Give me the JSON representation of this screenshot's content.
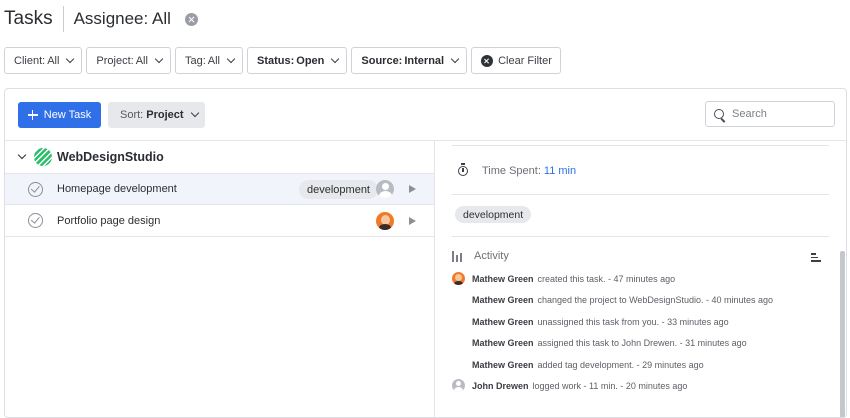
{
  "header": {
    "title": "Tasks",
    "assignee": "Assignee: All"
  },
  "filters": [
    {
      "label": "Client:",
      "value": "All",
      "bold": false
    },
    {
      "label": "Project:",
      "value": "All",
      "bold": false
    },
    {
      "label": "Tag:",
      "value": "All",
      "bold": false
    },
    {
      "label": "Status:",
      "value": "Open",
      "bold": true
    },
    {
      "label": "Source:",
      "value": "Internal",
      "bold": true
    }
  ],
  "clear_filter_label": "Clear Filter",
  "toolbar": {
    "new_task_label": "New Task",
    "sort_label": "Sort:",
    "sort_value": "Project",
    "search_placeholder": "Search"
  },
  "group": {
    "name": "WebDesignStudio",
    "tasks": [
      {
        "name": "Homepage development",
        "tag": "development",
        "avatar": "default-avatar"
      },
      {
        "name": "Portfolio page design",
        "tag": "",
        "avatar": "photo-avatar"
      }
    ]
  },
  "detail": {
    "time_label": "Time Spent:",
    "time_value": "11 min",
    "tag": "development",
    "activity_label": "Activity",
    "activity": [
      {
        "user": "Mathew Green",
        "text": "created this task. - 47 minutes ago",
        "avatar": "photo"
      },
      {
        "user": "Mathew Green",
        "text": "changed the project to WebDesignStudio. - 40 minutes ago",
        "avatar": ""
      },
      {
        "user": "Mathew Green",
        "text": "unassigned this task from you. - 33 minutes ago",
        "avatar": ""
      },
      {
        "user": "Mathew Green",
        "text": "assigned this task to John Drewen. - 31 minutes ago",
        "avatar": ""
      },
      {
        "user": "Mathew Green",
        "text": "added tag development. - 29 minutes ago",
        "avatar": ""
      },
      {
        "user": "John Drewen",
        "text": "logged work - 11 min. - 20 minutes ago",
        "avatar": "gray"
      }
    ]
  },
  "colors": {
    "primary": "#2f6fe8",
    "project": "#2dbe6c"
  }
}
